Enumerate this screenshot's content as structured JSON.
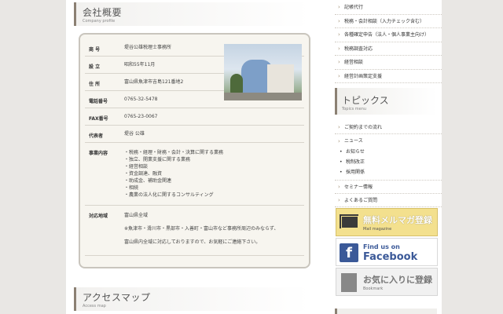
{
  "profile": {
    "title_jp": "会社概要",
    "title_en": "Company profile",
    "rows": [
      {
        "label": "商 号",
        "value": "堤谷公雄税理士事務所"
      },
      {
        "label": "設 立",
        "value": "昭和55年11月"
      },
      {
        "label": "住 所",
        "value": "富山県魚津市吉島121番地2"
      },
      {
        "label": "電話番号",
        "value": "0765-32-5478"
      },
      {
        "label": "FAX番号",
        "value": "0765-23-0067"
      },
      {
        "label": "代表者",
        "value": "堤谷 公雄"
      }
    ],
    "business_label": "事業内容",
    "business_items": [
      "・税務・経理・財務・会計・決算に関する業務",
      "・独立、開業支援に関する業務",
      "・経営相談",
      "・資金調達、融資",
      "・助成金、補助金関連",
      "・相続",
      "・農業の法人化に関するコンサルティング"
    ],
    "area_label": "対応地域",
    "area_lines": [
      "富山県全域",
      "※魚津市・滑川市・黒部市・入善町・富山市など事務所周辺のみならず、",
      "富山県内全域に対応しておりますので、お気軽にご連絡下さい。"
    ]
  },
  "access": {
    "title_jp": "アクセスマップ",
    "title_en": "Access map"
  },
  "sidebar": {
    "services": [
      "記帳代行",
      "税務・会計相談（入力チェック含む）",
      "各種確定申告（法人・個人事業主向け）",
      "税務調査対応",
      "経営相談",
      "経営計画策定支援"
    ],
    "topics_title_jp": "トピックス",
    "topics_title_en": "Topics menu",
    "topics": {
      "contract": "ご契約までの流れ",
      "news": "ニュース",
      "news_sub": [
        "お知らせ",
        "税制改正",
        "採用関係"
      ],
      "seminar": "セミナー情報",
      "faq": "よくあるご質問"
    },
    "banners": {
      "mail_main": "無料メルマガ登録",
      "mail_sub": "Mail magazine",
      "fb_line1": "Find us on",
      "fb_line2": "Facebook",
      "bm_main": "お気に入りに登録",
      "bm_sub": "Bookmark"
    }
  }
}
